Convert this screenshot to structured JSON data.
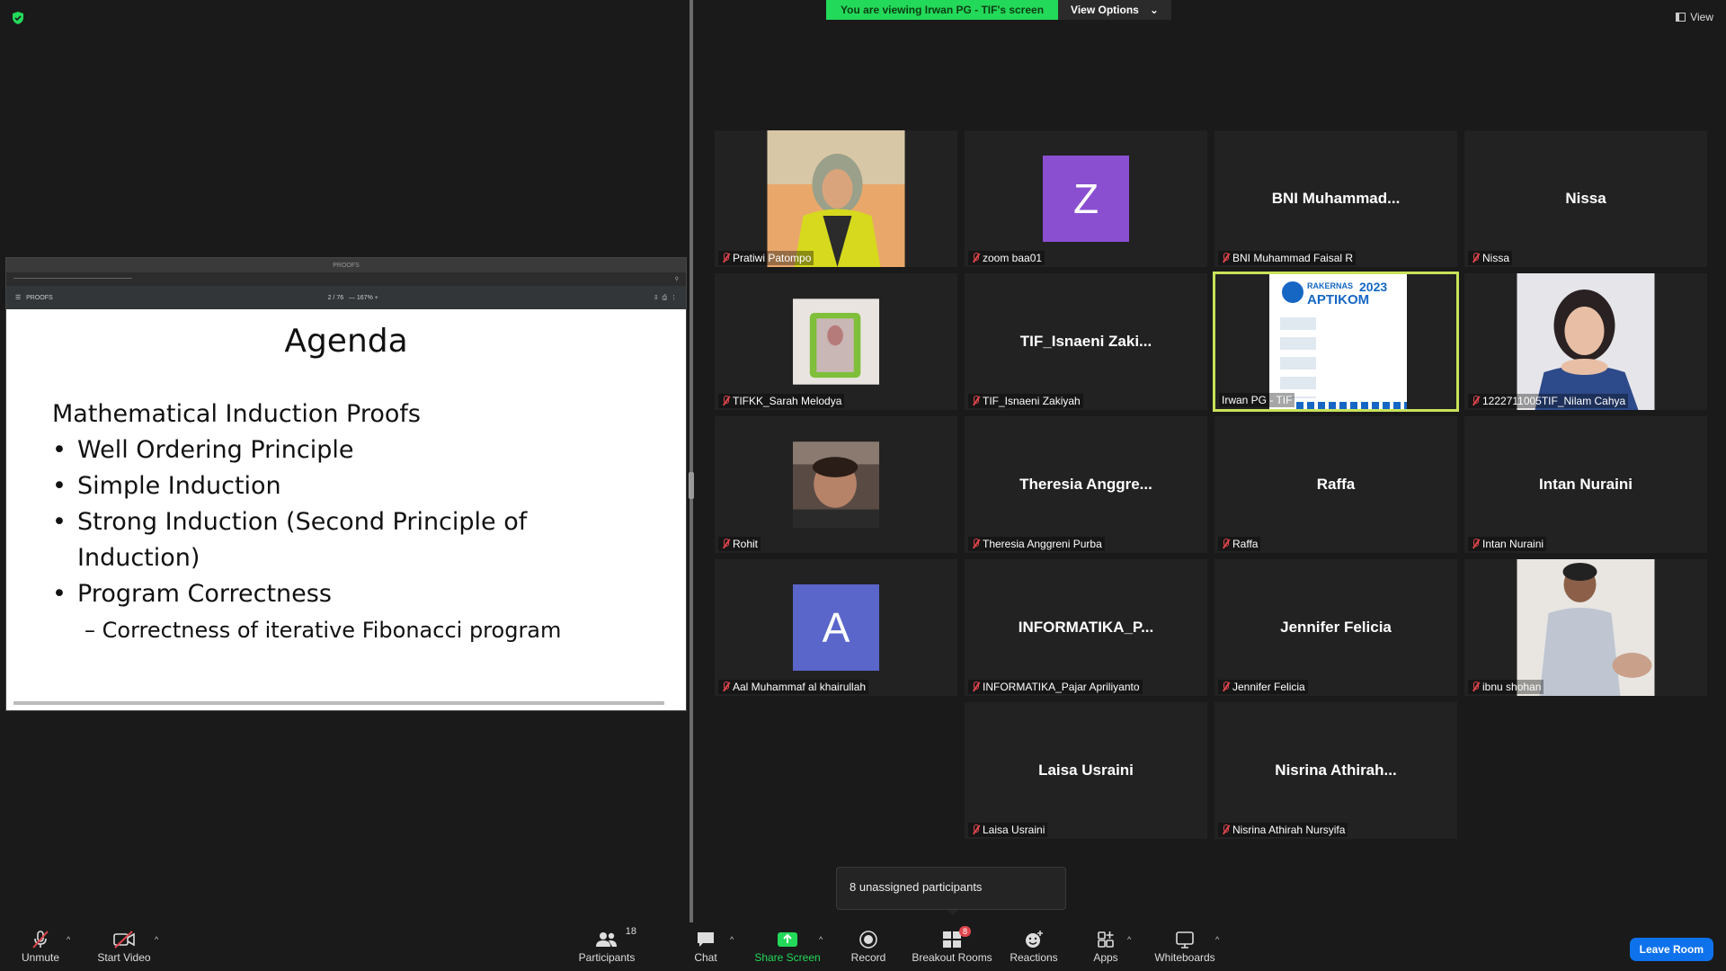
{
  "banner": {
    "viewing_text": "You are viewing Irwan PG - TIF's screen",
    "view_options_label": "View Options"
  },
  "view_button_label": "View",
  "shared_screen": {
    "pdf_filename": "PROOFS",
    "page_indicator": "2 / 76",
    "zoom_level": "167%",
    "slide": {
      "title": "Agenda",
      "heading": "Mathematical Induction Proofs",
      "bullets": [
        "Well Ordering Principle",
        "Simple Induction",
        "Strong Induction (Second Principle of",
        "Induction)",
        "Program Correctness"
      ],
      "sub_bullet": "– Correctness of iterative Fibonacci program"
    }
  },
  "participants": [
    {
      "name": "Pratiwi Patompo"
    },
    {
      "name": "zoom baa01",
      "initial": "Z",
      "color": "#8a4fd1"
    },
    {
      "name": "BNI Muhammad Faisal R",
      "display": "BNI  Muhammad..."
    },
    {
      "name": "Nissa",
      "display": "Nissa"
    },
    {
      "name": "TIFKK_Sarah Melodya"
    },
    {
      "name": "TIF_Isnaeni Zakiyah",
      "display": "TIF_Isnaeni  Zaki..."
    },
    {
      "name": "Irwan PG - TIF",
      "share_logo_year": "2023",
      "share_logo_text": "RAKERNAS",
      "share_logo_org": "APTIKOM"
    },
    {
      "name": "1222711005TIF_Nilam Cahya"
    },
    {
      "name": "Rohit"
    },
    {
      "name": "Theresia Anggreni Purba",
      "display": "Theresia  Anggre..."
    },
    {
      "name": "Raffa",
      "display": "Raffa"
    },
    {
      "name": "Intan Nuraini",
      "display": "Intan Nuraini"
    },
    {
      "name": "Aal Muhammaf al khairullah",
      "initial": "A",
      "color": "#5a66c9"
    },
    {
      "name": "INFORMATIKA_Pajar Apriliyanto",
      "display": "INFORMATIKA_P..."
    },
    {
      "name": "Jennifer Felicia",
      "display": "Jennifer Felicia"
    },
    {
      "name": "ibnu shohan"
    },
    {
      "name": "Laisa Usraini",
      "display": "Laisa Usraini"
    },
    {
      "name": "Nisrina Athirah Nursyifa",
      "display": "Nisrina  Athirah..."
    }
  ],
  "tooltip": "8 unassigned participants",
  "toolbar": {
    "unmute": "Unmute",
    "start_video": "Start Video",
    "participants": "Participants",
    "participants_count": "18",
    "chat": "Chat",
    "share_screen": "Share Screen",
    "record": "Record",
    "breakout_rooms": "Breakout Rooms",
    "breakout_badge": "8",
    "reactions": "Reactions",
    "apps": "Apps",
    "whiteboards": "Whiteboards",
    "leave": "Leave Room"
  },
  "colors": {
    "accent_green": "#23d959",
    "active_speaker_border": "#c9e25a",
    "leave_blue": "#0e72ed",
    "mic_off_red": "#e0454c"
  }
}
